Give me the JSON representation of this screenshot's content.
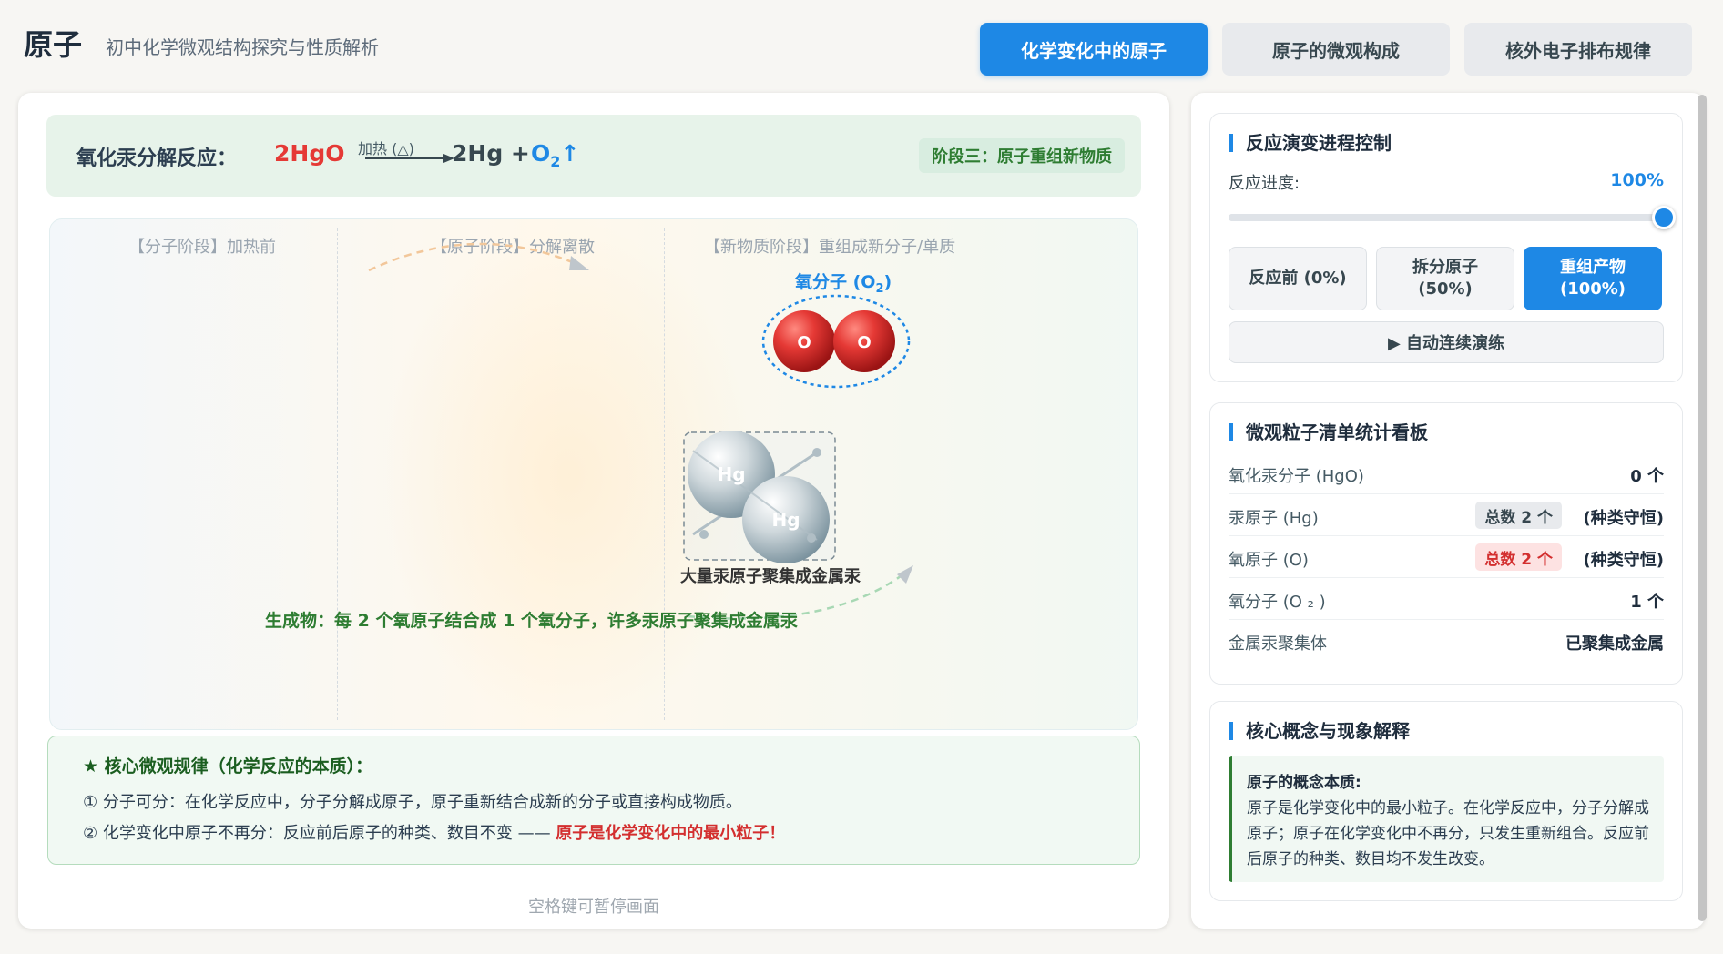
{
  "header": {
    "title": "原子",
    "subtitle": "初中化学微观结构探究与性质解析",
    "tabs": [
      {
        "label": "化学变化中的原子",
        "active": true
      },
      {
        "label": "原子的微观构成",
        "active": false
      },
      {
        "label": "核外电子排布规律",
        "active": false
      }
    ]
  },
  "equation": {
    "label": "氧化汞分解反应：",
    "reactant": "2HgO",
    "condition": "加热 (△)",
    "product1": "2Hg +",
    "product2_base": "O",
    "product2_sub": "2",
    "product2_arrow": "↑",
    "stage_badge": "阶段三：原子重组新物质"
  },
  "stage_area": {
    "phase_labels": [
      "【分子阶段】加热前",
      "【原子阶段】分解离散",
      "【新物质阶段】重组成新分子/单质"
    ],
    "o2_label_base": "氧分子 (O",
    "o2_label_sub": "2",
    "o2_label_end": ")",
    "o_atom_symbol": "O",
    "hg_atom_symbol": "Hg",
    "hg_caption": "大量汞原子聚集成金属汞",
    "product_note": "生成物：每 2 个氧原子结合成 1 个氧分子，许多汞原子聚集成金属汞"
  },
  "rules": {
    "title": "★ 核心微观规律（化学反应的本质）：",
    "line1": "① 分子可分：在化学反应中，分子分解成原子，原子重新结合成新的分子或直接构成物质。",
    "line2_prefix": "② 化学变化中原子不再分：反应前后原子的种类、数目不变 —— ",
    "line2_highlight": "原子是化学变化中的最小粒子！"
  },
  "hint": "空格键可暂停画面",
  "control": {
    "title": "反应演变进程控制",
    "progress_label": "反应进度:",
    "progress_value": "100%",
    "progress_fraction": 1.0,
    "buttons": [
      {
        "line1": "反应前 (0%)",
        "line2": "",
        "active": false
      },
      {
        "line1": "拆分原子",
        "line2": "(50%)",
        "active": false
      },
      {
        "line1": "重组产物",
        "line2": "(100%)",
        "active": true
      }
    ],
    "auto_button": "▶ 自动连续演练"
  },
  "stats": {
    "title": "微观粒子清单统计看板",
    "rows": [
      {
        "name": "氧化汞分子 (HgO)",
        "value": "0 个"
      },
      {
        "name": "汞原子 (Hg)",
        "badge": "总数 2 个",
        "note": "(种类守恒)"
      },
      {
        "name": "氧原子 (O)",
        "badge": "总数 2 个",
        "note": "(种类守恒)"
      },
      {
        "name": "氧分子 (O ₂ )",
        "value": "1 个"
      },
      {
        "name": "金属汞聚集体",
        "value": "已聚集成金属"
      }
    ]
  },
  "concept": {
    "title": "核心概念与现象解释",
    "head": "原子的概念本质:",
    "body": "原子是化学变化中的最小粒子。在化学反应中，分子分解成原子；原子在化学变化中不再分，只发生重新组合。反应前后原子的种类、数目均不发生改变。"
  },
  "colors": {
    "accent": "#1e88e5",
    "reactant_red": "#e53935",
    "success_green": "#2e7d32",
    "oxygen_atom": "#d32f2f",
    "mercury_atom": "#b0bec5"
  }
}
